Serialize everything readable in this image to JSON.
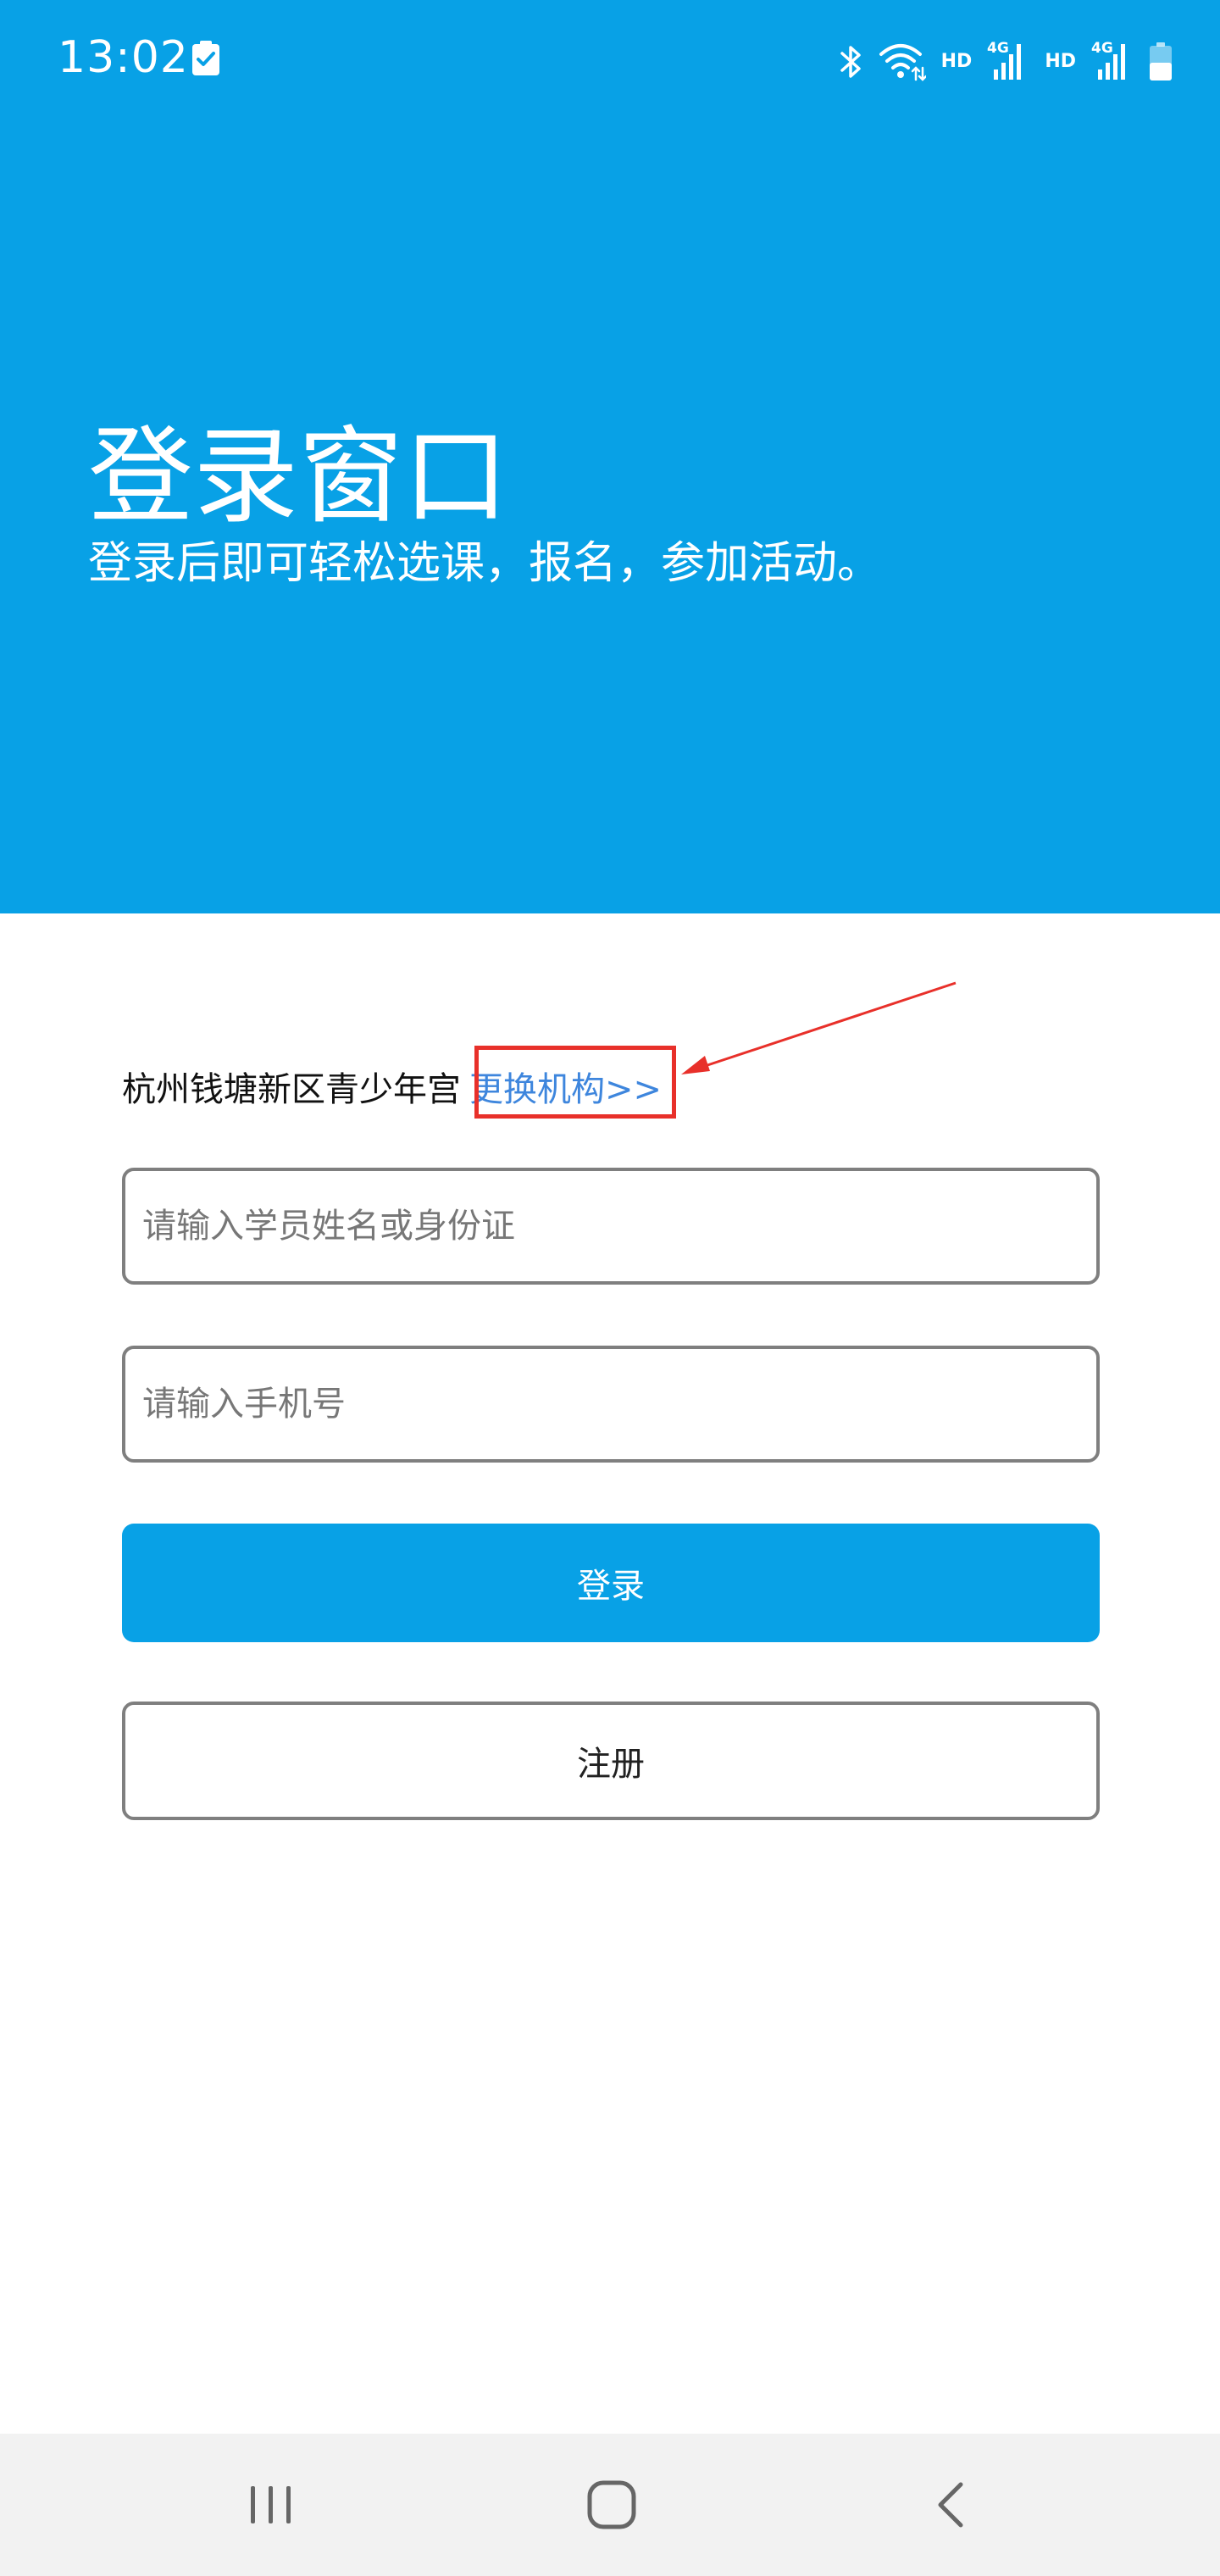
{
  "status_bar": {
    "time": "13:02",
    "hd_label_1": "HD",
    "hd_label_2": "HD",
    "network_label_1": "4G",
    "network_label_2": "4G",
    "icons": [
      "task-check-icon",
      "bluetooth-icon",
      "wifi-icon",
      "signal-icon",
      "battery-icon"
    ]
  },
  "header": {
    "title": "登录窗口",
    "subtitle": "登录后即可轻松选课，报名，参加活动。"
  },
  "organization": {
    "name": "杭州钱塘新区青少年宫",
    "change_link": "更换机构>>"
  },
  "form": {
    "name_placeholder": "请输入学员姓名或身份证",
    "name_value": "",
    "phone_placeholder": "请输入手机号",
    "phone_value": "",
    "login_label": "登录",
    "register_label": "注册"
  },
  "nav": {
    "icons": [
      "recents-icon",
      "home-icon",
      "back-icon"
    ]
  },
  "colors": {
    "primary": "#08a1e6",
    "link": "#3e86dd",
    "annotation": "#e8302a",
    "nav_background": "#f2f2f2"
  }
}
